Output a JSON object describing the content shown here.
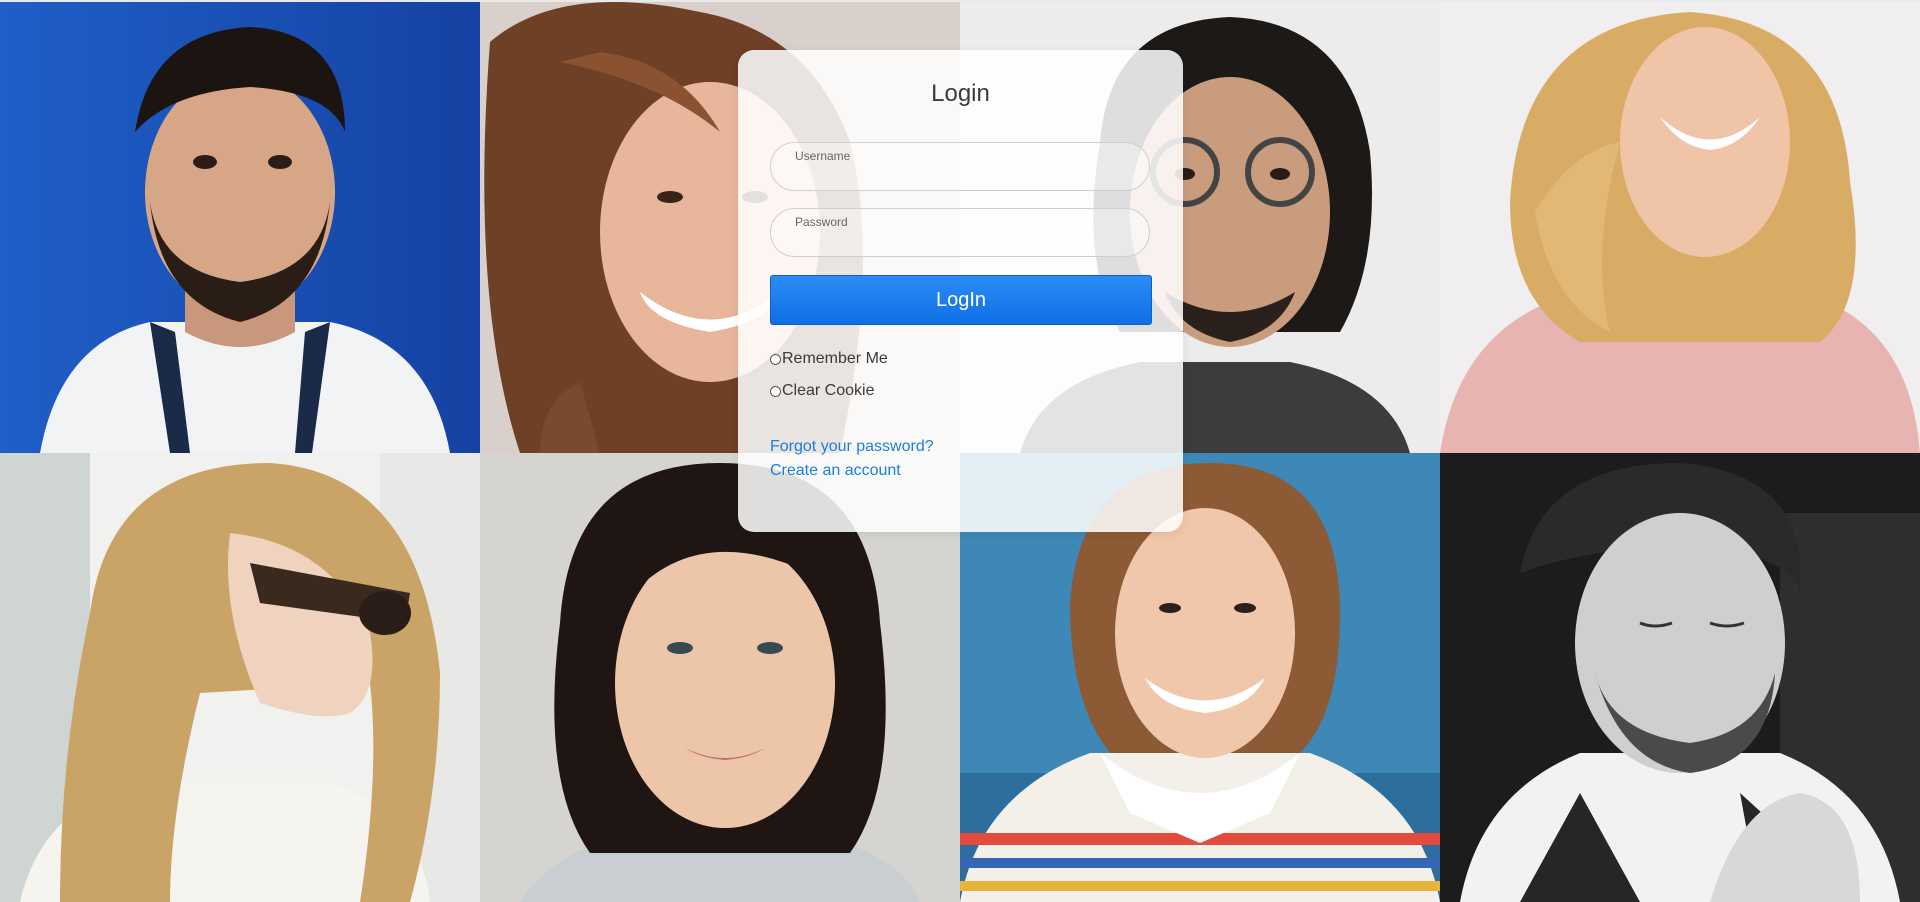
{
  "login": {
    "title": "Login",
    "username_label": "Username",
    "username_value": "",
    "password_label": "Password",
    "password_value": "",
    "button_label": "LogIn",
    "remember_me_label": "Remember Me",
    "clear_cookie_label": "Clear Cookie",
    "forgot_password_link": "Forgot your password?",
    "create_account_link": "Create an account"
  },
  "colors": {
    "accent": "#1a7fe0",
    "button": "#1875ec",
    "card": "#ffffff"
  },
  "background_photos": [
    "portrait-man-beard-blue-wall",
    "portrait-woman-curly-hair-laughing",
    "portrait-man-glasses-long-hair",
    "portrait-woman-blonde-laughing",
    "portrait-woman-sunglasses-profile",
    "portrait-woman-dark-bob-smiling",
    "portrait-woman-striped-shirt-smiling",
    "portrait-man-bw-looking-down"
  ]
}
